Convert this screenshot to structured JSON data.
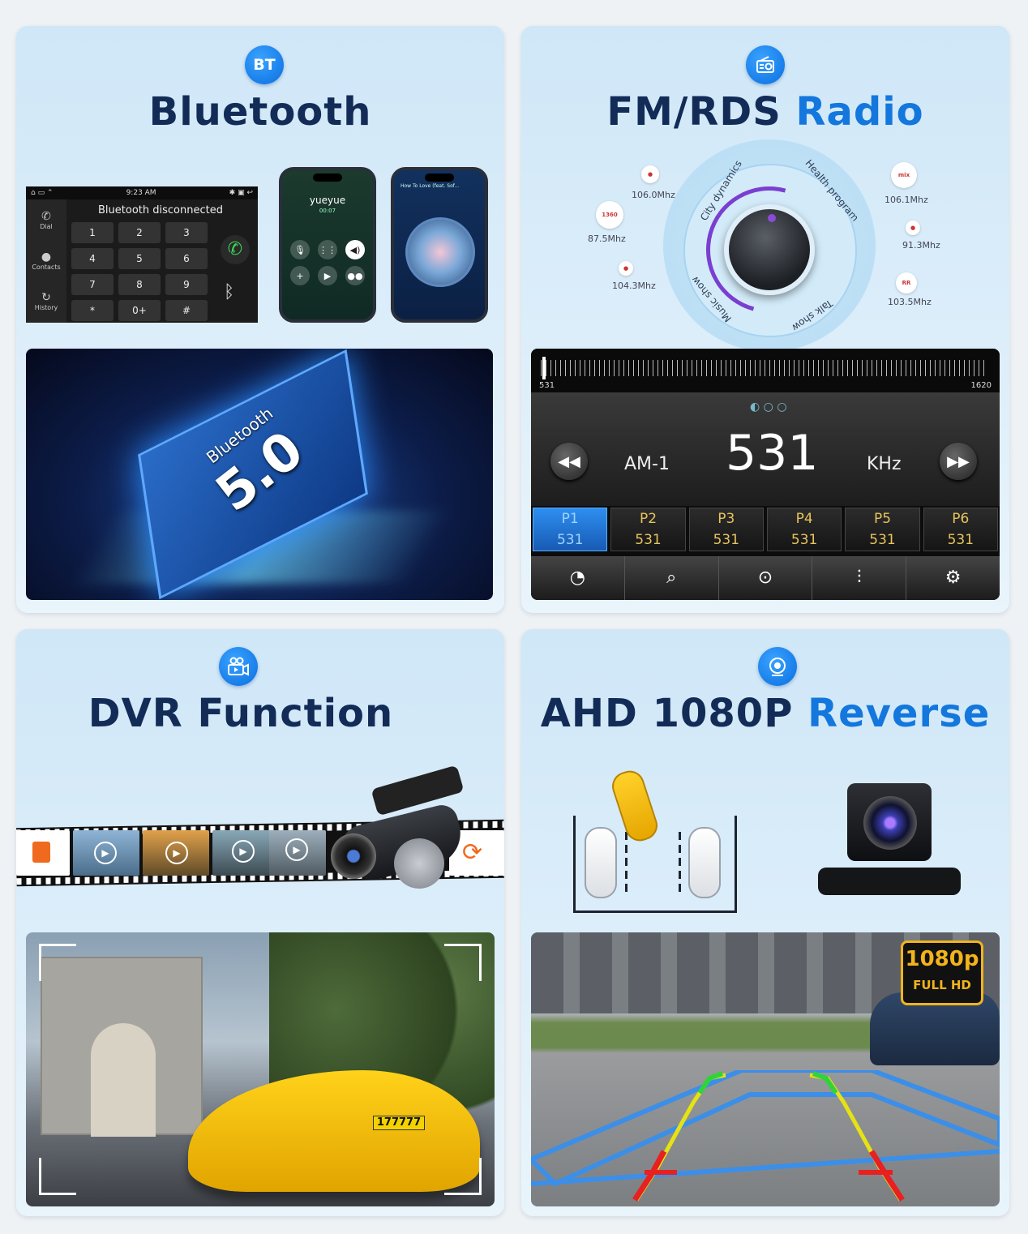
{
  "panels": {
    "bluetooth": {
      "badge": "BT",
      "title": "Bluetooth",
      "dialer": {
        "time": "9:23 AM",
        "status": "Bluetooth disconnected",
        "side_items": [
          "Dial",
          "Contacts",
          "History"
        ],
        "keys": [
          "1",
          "2",
          "3",
          "4",
          "5",
          "6",
          "7",
          "8",
          "9",
          "*",
          "0+",
          "#"
        ]
      },
      "phone_call": {
        "name": "yueyue",
        "duration": "00:07",
        "buttons": [
          "mute",
          "keypad",
          "speaker",
          "add call",
          "FaceTime",
          "contacts"
        ]
      },
      "phone_music": {
        "song": "How To Love (feat. Sof..."
      },
      "chip": {
        "line1": "Bluetooth",
        "line2": "5.0"
      }
    },
    "radio": {
      "badge_icon": "radio-icon",
      "title_a": "FM/RDS",
      "title_b": "Radio",
      "dial_labels": [
        "City dynamics",
        "Health program",
        "Music show",
        "Talk show"
      ],
      "stations_left": [
        "106.0Mhz",
        "87.5Mhz",
        "104.3Mhz"
      ],
      "stations_right": [
        "106.1Mhz",
        "91.3Mhz",
        "103.5Mhz"
      ],
      "tuner": {
        "scale_min": "531",
        "scale_max": "1620",
        "band": "AM-1",
        "frequency": "531",
        "unit": "KHz",
        "presets": [
          {
            "label": "P1",
            "value": "531"
          },
          {
            "label": "P2",
            "value": "531"
          },
          {
            "label": "P3",
            "value": "531"
          },
          {
            "label": "P4",
            "value": "531"
          },
          {
            "label": "P5",
            "value": "531"
          },
          {
            "label": "P6",
            "value": "531"
          }
        ],
        "active_preset": 0
      }
    },
    "dvr": {
      "badge_icon": "dashcam-icon",
      "title_a": "DVR",
      "title_b": "Function",
      "plate": "177777"
    },
    "ahd": {
      "badge_icon": "camera-icon",
      "title_a": "AHD 1080P",
      "title_b": "Reverse",
      "badge_top": "1080p",
      "badge_bottom": "FULL HD"
    }
  },
  "colors": {
    "accent": "#1377dd",
    "title": "#132c57",
    "preset_active": "#2e8ef0",
    "preset_text": "#e6c45c"
  }
}
